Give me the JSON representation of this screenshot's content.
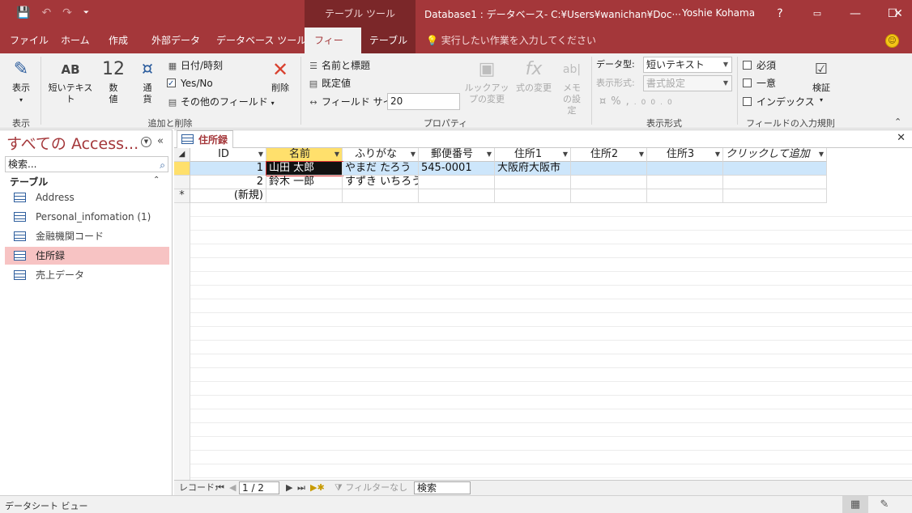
{
  "titlebar": {
    "context_tab_group": "テーブル ツール",
    "title": "Database1 : データベース- C:¥Users¥wanichan¥Doc···",
    "user": "Yoshie Kohama",
    "help": "?",
    "minimize": "—",
    "maximize": "☐",
    "close": "✕",
    "qat": {
      "save": "💾",
      "undo": "↶",
      "redo": "↷",
      "customize": "⏷"
    }
  },
  "tabs": [
    "ファイル",
    "ホーム",
    "作成",
    "外部データ",
    "データベース ツール",
    "フィールド",
    "テーブル"
  ],
  "tell_me": "実行したい作業を入力してください",
  "ribbon": {
    "groups": {
      "view": "表示",
      "add_delete": "追加と削除",
      "properties": "プロパティ",
      "formatting": "表示形式",
      "validation": "フィールドの入力規則"
    },
    "view_btn": "表示",
    "short_text_btn": {
      "icon": "AB",
      "label": "短いテキスト"
    },
    "number_btn": {
      "icon": "12",
      "label": "数値"
    },
    "currency_btn": {
      "label": "通貨"
    },
    "datetime_btn": "日付/時刻",
    "yesno_btn": "Yes/No",
    "more_fields_btn": "その他のフィールド",
    "delete_btn": "削除",
    "name_caption_btn": "名前と標題",
    "default_value_btn": "既定値",
    "field_size_label": "フィールド サイズ",
    "field_size_value": "20",
    "lookup_btn": "ルックアップの変更",
    "expression_btn": "式の変更",
    "memo_btn": "メモの設定",
    "data_type_label": "データ型:",
    "data_type_value": "短いテキスト",
    "format_label": "表示形式:",
    "format_value": "書式設定",
    "required_label": "必須",
    "unique_label": "一意",
    "indexed_label": "インデックス",
    "validation_btn": "検証"
  },
  "nav": {
    "title": "すべての Access...",
    "search_placeholder": "検索...",
    "group": "テーブル",
    "items": [
      "Address",
      "Personal_infomation (1)",
      "金融機関コード",
      "住所録",
      "売上データ"
    ],
    "selected_index": 3
  },
  "document": {
    "tab_label": "住所録",
    "columns": [
      "ID",
      "名前",
      "ふりがな",
      "郵便番号",
      "住所1",
      "住所2",
      "住所3",
      "クリックして追加"
    ],
    "rows": [
      [
        "1",
        "山田 太郎",
        "やまだ たろう",
        "545-0001",
        "大阪府大阪市",
        "",
        ""
      ],
      [
        "2",
        "鈴木 一郎",
        "すずき いちろう",
        "",
        "",
        "",
        ""
      ]
    ],
    "new_row_label": "(新規)",
    "new_row_marker": "*"
  },
  "record_nav": {
    "label": "レコード:",
    "position": "1 / 2",
    "filter": "フィルターなし",
    "search": "検索"
  },
  "status": {
    "text": "データシート ビュー"
  }
}
